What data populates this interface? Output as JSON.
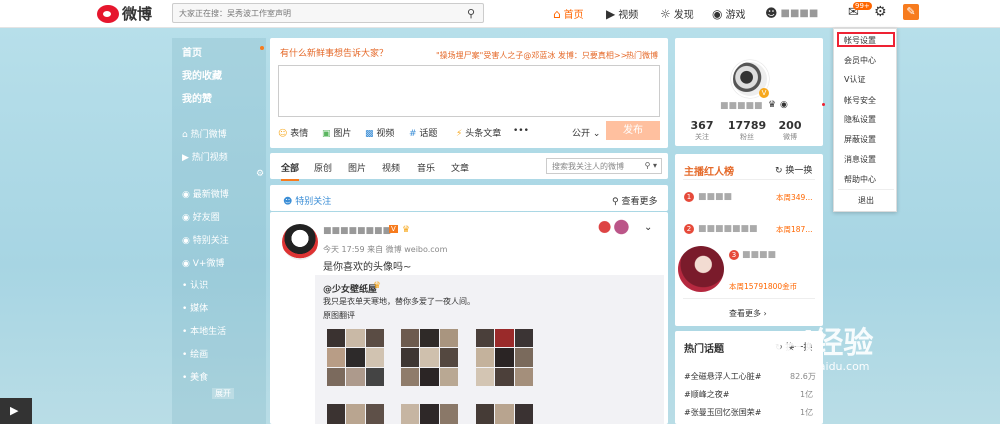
{
  "topbar": {
    "logo_text": "微博",
    "search_placeholder": "大家正在搜：吴秀波工作室声明",
    "nav": [
      {
        "label": "首页"
      },
      {
        "label": "视频"
      },
      {
        "label": "发现"
      },
      {
        "label": "游戏"
      },
      {
        "label": "■■■■"
      }
    ],
    "msg_badge": "99+"
  },
  "leftnav": {
    "primary": [
      "首页",
      "我的收藏",
      "我的赞"
    ],
    "hot": [
      "热门微博",
      "热门视频"
    ],
    "groups": [
      "最新微博",
      "好友圈",
      "特别关注",
      "V+微博"
    ],
    "categories": [
      "认识",
      "媒体",
      "本地生活",
      "绘画",
      "美食"
    ],
    "expand": "展开"
  },
  "composer": {
    "prompt": "有什么新鲜事想告诉大家？",
    "hot_topic": "\"操场埋尸案\"受害人之子@邓蓝冰 发博：只要真相>>",
    "hot_link": "热门微博",
    "tools": [
      "表情",
      "图片",
      "视频",
      "话题",
      "头条文章",
      "•••"
    ],
    "privacy": "公开",
    "publish": "发布"
  },
  "tabs": {
    "items": [
      "全部",
      "原创",
      "图片",
      "视频",
      "音乐",
      "文章"
    ],
    "search_placeholder": "搜索我关注人的微博"
  },
  "feed_header": {
    "special": "特别关注",
    "more": "查看更多"
  },
  "post": {
    "author": "■■■■■■■■",
    "meta": "今天 17:59 来自 微博 weibo.com",
    "text": "是你喜欢的头像吗~",
    "repost_author": "@少女壁纸屋",
    "repost_text": "我只是衣单天寒地，替你多爱了一夜人间。",
    "repost_link": "原图翻评"
  },
  "profile": {
    "name": "■■■■■",
    "stats": [
      {
        "num": "367",
        "label": "关注"
      },
      {
        "num": "17789",
        "label": "粉丝"
      },
      {
        "num": "200",
        "label": "微博"
      }
    ]
  },
  "hotlist": {
    "title": "主播红人榜",
    "refresh": "换一换",
    "rows": [
      {
        "rank": "1",
        "name": "■■■■",
        "meta": "本周349..."
      },
      {
        "rank": "2",
        "name": "■■■■■■■",
        "meta": "本周187..."
      },
      {
        "rank": "3",
        "name": "■■■■",
        "meta": "本周15791800金币"
      }
    ],
    "more": "查看更多"
  },
  "topics": {
    "title": "热门话题",
    "refresh": "换一换",
    "rows": [
      {
        "name": "#全磁悬浮人工心脏#",
        "count": "82.6万"
      },
      {
        "name": "#顺峰之夜#",
        "count": "1亿"
      },
      {
        "name": "#张曼玉回忆张国荣#",
        "count": "1亿"
      }
    ]
  },
  "account_menu": {
    "items": [
      "帐号设置",
      "会员中心",
      "V认证",
      "帐号安全",
      "隐私设置",
      "屏蔽设置",
      "消息设置",
      "帮助中心",
      "退出"
    ]
  },
  "watermark": {
    "brand": "Bai经验",
    "url": "jingyan.baidu.com"
  }
}
